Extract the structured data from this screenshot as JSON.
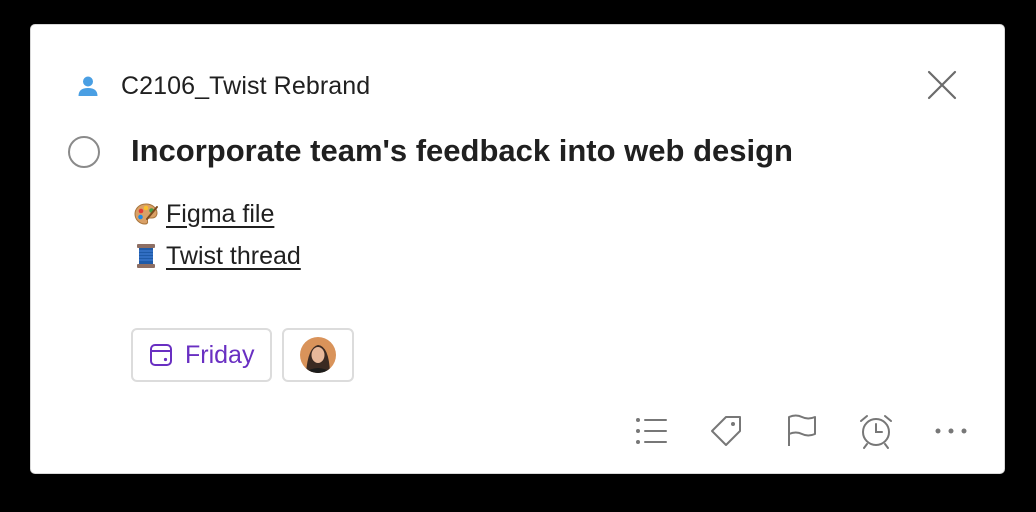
{
  "project": {
    "name": "C2106_Twist Rebrand",
    "icon": "person-icon",
    "icon_color": "#4a9fe3"
  },
  "task": {
    "title": "Incorporate team's feedback into web design"
  },
  "links": [
    {
      "emoji": "artist-palette",
      "label": "Figma file"
    },
    {
      "emoji": "spool-of-thread",
      "label": "Twist thread"
    }
  ],
  "due": {
    "label": "Friday",
    "color": "#692fc2"
  },
  "assignee": {
    "icon": "avatar"
  },
  "toolbar": [
    "subtasks-icon",
    "label-icon",
    "flag-icon",
    "reminder-icon",
    "more-icon"
  ]
}
